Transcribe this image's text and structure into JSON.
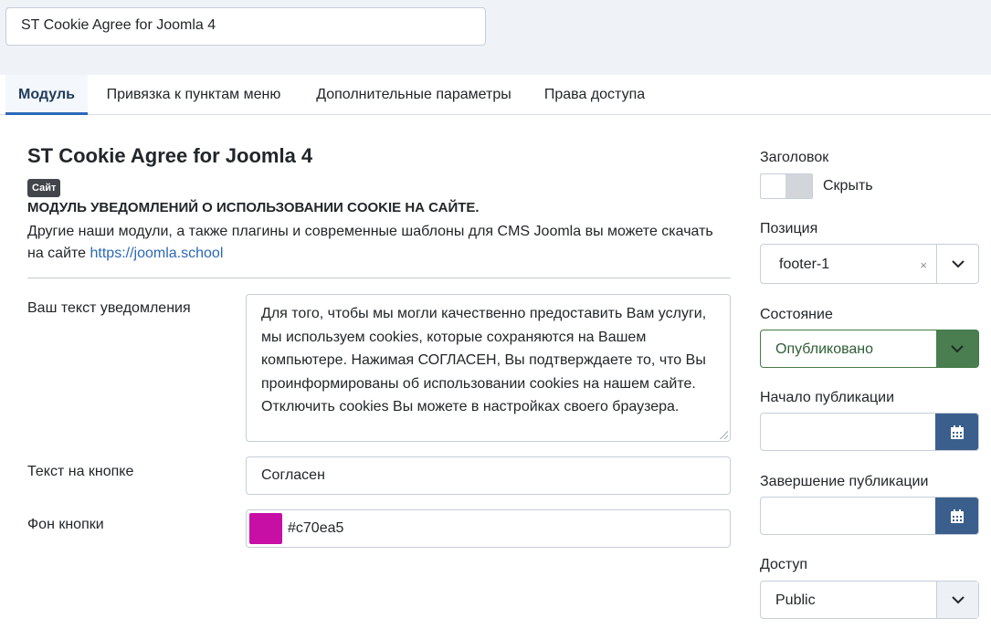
{
  "module_title_input": "ST Cookie Agree for Joomla 4",
  "tabs": [
    {
      "label": "Модуль"
    },
    {
      "label": "Привязка к пунктам меню"
    },
    {
      "label": "Дополнительные параметры"
    },
    {
      "label": "Права доступа"
    }
  ],
  "module_info": {
    "title": "ST Cookie Agree for Joomla 4",
    "badge": "Сайт",
    "heading": "МОДУЛЬ УВЕДОМЛЕНИЙ О ИСПОЛЬЗОВАНИИ COOKIE НА САЙТЕ.",
    "description_line1": "Другие наши модули, а также плагины и современные шаблоны для CMS Joomla вы можете скачать",
    "description_line2_prefix": "на сайте",
    "link_text": "https://joomla.school"
  },
  "fields": {
    "notice_label": "Ваш текст уведомления",
    "notice_value": "Для того, чтобы мы могли качественно предоставить Вам услуги, мы используем cookies, которые сохраняются на Вашем компьютере. Нажимая СОГЛАСЕН, Вы подтверждаете то, что Вы проинформированы об использовании cookies на нашем сайте. Отключить cookies Вы можете в настройках своего браузера.",
    "button_text_label": "Текст на кнопке",
    "button_text_value": "Согласен",
    "button_bg_label": "Фон кнопки",
    "button_bg_value": "#c70ea5"
  },
  "sidebar": {
    "title_label": "Заголовок",
    "hide_label": "Скрыть",
    "position_label": "Позиция",
    "position_value": "footer-1",
    "clear_glyph": "×",
    "state_label": "Состояние",
    "state_value": "Опубликовано",
    "publish_up_label": "Начало публикации",
    "publish_down_label": "Завершение публикации",
    "access_label": "Доступ",
    "access_value": "Public"
  },
  "colors": {
    "accent": "#2a69b8",
    "published_green": "#4a7d4f",
    "calendar_button": "#3b5f8c",
    "swatch": "#c70ea5"
  },
  "icons": {
    "calendar": "calendar-icon",
    "chevron": "chevron-down-icon",
    "clear": "close-icon"
  }
}
